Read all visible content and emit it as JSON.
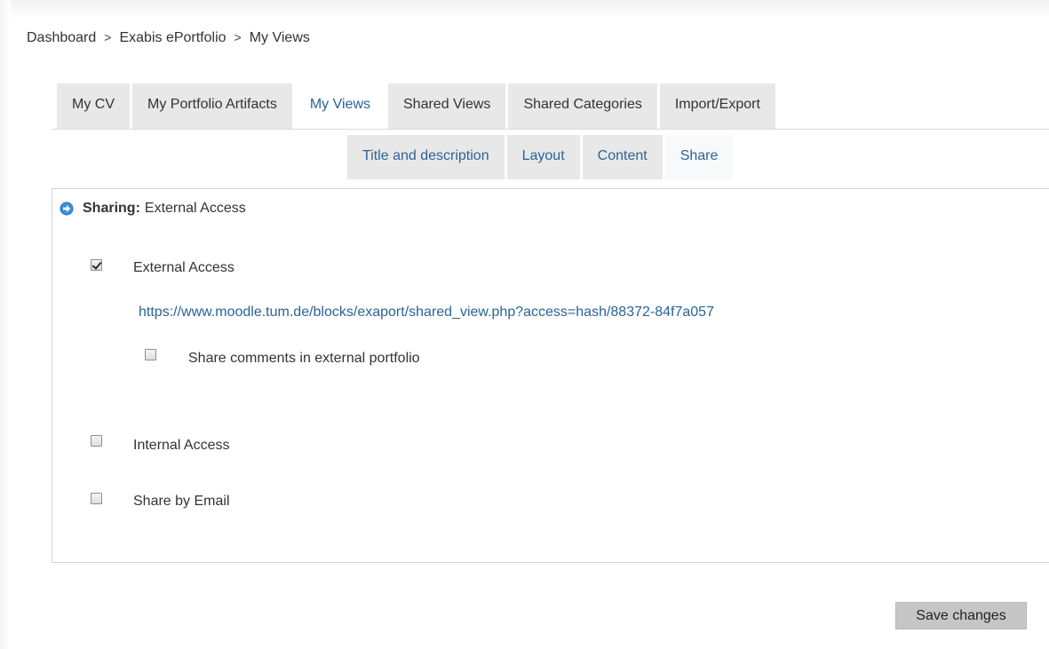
{
  "breadcrumb": {
    "items": [
      "Dashboard",
      "Exabis ePortfolio",
      "My Views"
    ],
    "separator": ">"
  },
  "tabs": [
    {
      "label": "My CV",
      "active": false
    },
    {
      "label": "My Portfolio Artifacts",
      "active": false
    },
    {
      "label": "My Views",
      "active": true
    },
    {
      "label": "Shared Views",
      "active": false
    },
    {
      "label": "Shared Categories",
      "active": false
    },
    {
      "label": "Import/Export",
      "active": false
    }
  ],
  "subtabs": [
    {
      "label": "Title and description",
      "active": false
    },
    {
      "label": "Layout",
      "active": false
    },
    {
      "label": "Content",
      "active": false
    },
    {
      "label": "Share",
      "active": true
    }
  ],
  "section": {
    "icon": "arrow-right-circle-icon",
    "label_bold": "Sharing:",
    "label": "External Access"
  },
  "options": {
    "external_access": {
      "label": "External Access",
      "checked": true
    },
    "external_link": "https://www.moodle.tum.de/blocks/exaport/shared_view.php?access=hash/88372-84f7a057",
    "share_comments": {
      "label": "Share comments in external portfolio",
      "checked": false
    },
    "internal_access": {
      "label": "Internal Access",
      "checked": false
    },
    "share_by_email": {
      "label": "Share by Email",
      "checked": false
    }
  },
  "buttons": {
    "save_label": "Save changes"
  },
  "colors": {
    "link": "#2a6496",
    "tab_bg": "#e8e8e8",
    "icon_blue": "#1f6fc5"
  }
}
